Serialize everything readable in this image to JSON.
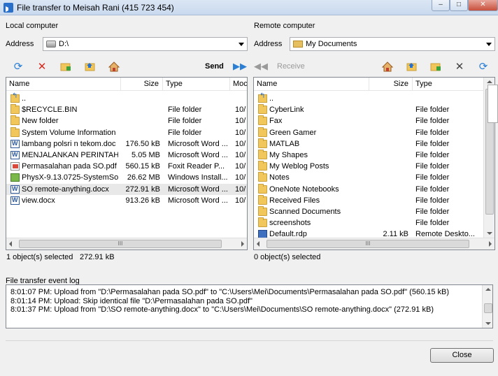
{
  "window": {
    "title": "File transfer to Meisah Rani (415 723 454)",
    "minimize_glyph": "–",
    "maximize_glyph": "□",
    "close_glyph": "✕"
  },
  "local": {
    "section_title": "Local computer",
    "address_label": "Address",
    "address_value": "D:\\",
    "send_label": "Send",
    "columns": [
      "Name",
      "Size",
      "Type",
      "Moc"
    ],
    "files": [
      {
        "name": "..",
        "size": "",
        "type": "",
        "mod": "",
        "icon": "updir"
      },
      {
        "name": "$RECYCLE.BIN",
        "size": "",
        "type": "File folder",
        "mod": "10/",
        "icon": "folder"
      },
      {
        "name": "New folder",
        "size": "",
        "type": "File folder",
        "mod": "10/",
        "icon": "folder"
      },
      {
        "name": "System Volume Information",
        "size": "",
        "type": "File folder",
        "mod": "10/",
        "icon": "folder"
      },
      {
        "name": "lambang polsri n tekom.doc",
        "size": "176.50 kB",
        "type": "Microsoft Word ...",
        "mod": "10/",
        "icon": "wordf"
      },
      {
        "name": "MENJALANKAN PERINTAH ...",
        "size": "5.05 MB",
        "type": "Microsoft Word ...",
        "mod": "10/",
        "icon": "wordf"
      },
      {
        "name": "Permasalahan pada SO.pdf",
        "size": "560.15 kB",
        "type": "Foxit Reader P...",
        "mod": "10/",
        "icon": "pdff"
      },
      {
        "name": "PhysX-9.13.0725-SystemSo...",
        "size": "26.62 MB",
        "type": "Windows Install...",
        "mod": "10/",
        "icon": "exef"
      },
      {
        "name": "SO remote-anything.docx",
        "size": "272.91 kB",
        "type": "Microsoft Word ...",
        "mod": "10/",
        "icon": "wordf",
        "selected": true
      },
      {
        "name": "view.docx",
        "size": "913.26 kB",
        "type": "Microsoft Word ...",
        "mod": "10/",
        "icon": "wordf"
      }
    ],
    "status_selected": "1 object(s) selected",
    "status_size": "272.91 kB"
  },
  "remote": {
    "section_title": "Remote computer",
    "address_label": "Address",
    "address_value": "My Documents",
    "receive_label": "Receive",
    "columns": [
      "Name",
      "Size",
      "Type"
    ],
    "files": [
      {
        "name": "..",
        "size": "",
        "type": "",
        "icon": "updir"
      },
      {
        "name": "CyberLink",
        "size": "",
        "type": "File folder",
        "icon": "folder"
      },
      {
        "name": "Fax",
        "size": "",
        "type": "File folder",
        "icon": "folder"
      },
      {
        "name": "Green Gamer",
        "size": "",
        "type": "File folder",
        "icon": "folder"
      },
      {
        "name": "MATLAB",
        "size": "",
        "type": "File folder",
        "icon": "folder"
      },
      {
        "name": "My Shapes",
        "size": "",
        "type": "File folder",
        "icon": "folder"
      },
      {
        "name": "My Weblog Posts",
        "size": "",
        "type": "File folder",
        "icon": "folder"
      },
      {
        "name": "Notes",
        "size": "",
        "type": "File folder",
        "icon": "folder"
      },
      {
        "name": "OneNote Notebooks",
        "size": "",
        "type": "File folder",
        "icon": "folder"
      },
      {
        "name": "Received Files",
        "size": "",
        "type": "File folder",
        "icon": "folder"
      },
      {
        "name": "Scanned Documents",
        "size": "",
        "type": "File folder",
        "icon": "folder"
      },
      {
        "name": "screenshots",
        "size": "",
        "type": "File folder",
        "icon": "folder"
      },
      {
        "name": "Default.rdp",
        "size": "2.11 kB",
        "type": "Remote Deskto...",
        "icon": "rdpf"
      }
    ],
    "status_selected": "0 object(s) selected"
  },
  "log": {
    "title": "File transfer event log",
    "lines": [
      "8:01:07 PM: Upload from \"D:\\Permasalahan pada SO.pdf\" to \"C:\\Users\\Mei\\Documents\\Permasalahan pada SO.pdf\" (560.15 kB)",
      "8:01:14 PM: Upload: Skip identical file \"D:\\Permasalahan pada SO.pdf\"",
      "8:01:37 PM: Upload from \"D:\\SO remote-anything.docx\" to \"C:\\Users\\Mei\\Documents\\SO remote-anything.docx\" (272.91 kB)"
    ]
  },
  "footer": {
    "close_label": "Close"
  },
  "scroll": {
    "thumb_grip": "III"
  },
  "icons": {
    "refresh": "refresh-icon",
    "delete": "delete-icon",
    "new_folder": "new-folder-icon",
    "up_folder": "up-folder-icon",
    "home": "home-icon",
    "send_arrow": "send-arrow-icon",
    "receive_arrow": "receive-arrow-icon"
  }
}
